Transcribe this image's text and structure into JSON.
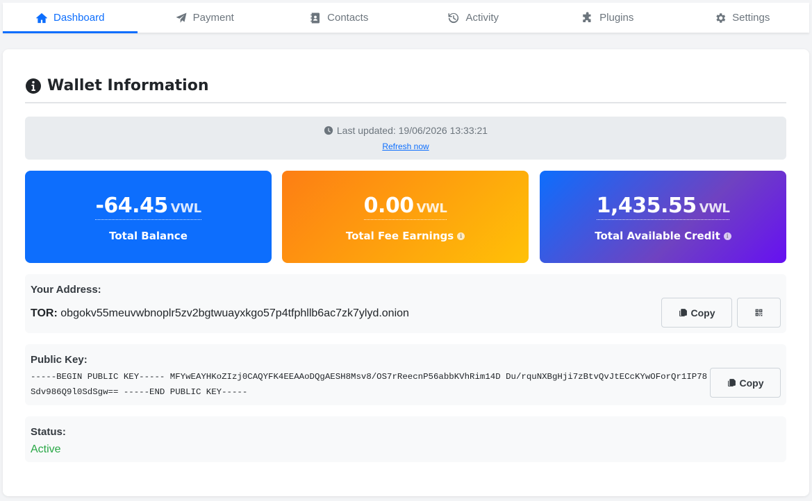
{
  "tabs": [
    {
      "label": "Dashboard",
      "icon": "home-icon",
      "active": true
    },
    {
      "label": "Payment",
      "icon": "paper-plane-icon",
      "active": false
    },
    {
      "label": "Contacts",
      "icon": "address-book-icon",
      "active": false
    },
    {
      "label": "Activity",
      "icon": "history-icon",
      "active": false
    },
    {
      "label": "Plugins",
      "icon": "puzzle-icon",
      "active": false
    },
    {
      "label": "Settings",
      "icon": "gear-icon",
      "active": false
    }
  ],
  "wallet": {
    "title": "Wallet Information",
    "last_updated": "Last updated: 19/06/2026 13:33:21",
    "refresh_label": "Refresh now",
    "stats": [
      {
        "amount": "-64.45",
        "unit": "VWL",
        "label": "Total Balance",
        "color": "#0d6efd"
      },
      {
        "amount": "0.00",
        "unit": "VWL",
        "label": "Total Fee Earnings",
        "color": "#fd7e14"
      },
      {
        "amount": "1,435.55",
        "unit": "VWL",
        "label": "Total Available Credit",
        "color": "#6610f2"
      }
    ],
    "address": {
      "label": "Your Address:",
      "prefix": "TOR:",
      "value": "obgokv55meuvwbnoplr5zv2bgtwuayxkgo57p4tfphllb6ac7zk7ylyd.onion",
      "copy_label": "Copy"
    },
    "public_key": {
      "label": "Public Key:",
      "value": "-----BEGIN PUBLIC KEY----- MFYwEAYHKoZIzj0CAQYFK4EEAAoDQgAESH8Msv8/OS7rReecnP56abbKVhRim14D Du/rquNXBgHji7zBtvQvJtECcKYwOForQr1IP78Sdv986Q9l0SdSgw== -----END PUBLIC KEY-----",
      "copy_label": "Copy"
    },
    "status": {
      "label": "Status:",
      "value": "Active",
      "color": "#28a745"
    }
  }
}
